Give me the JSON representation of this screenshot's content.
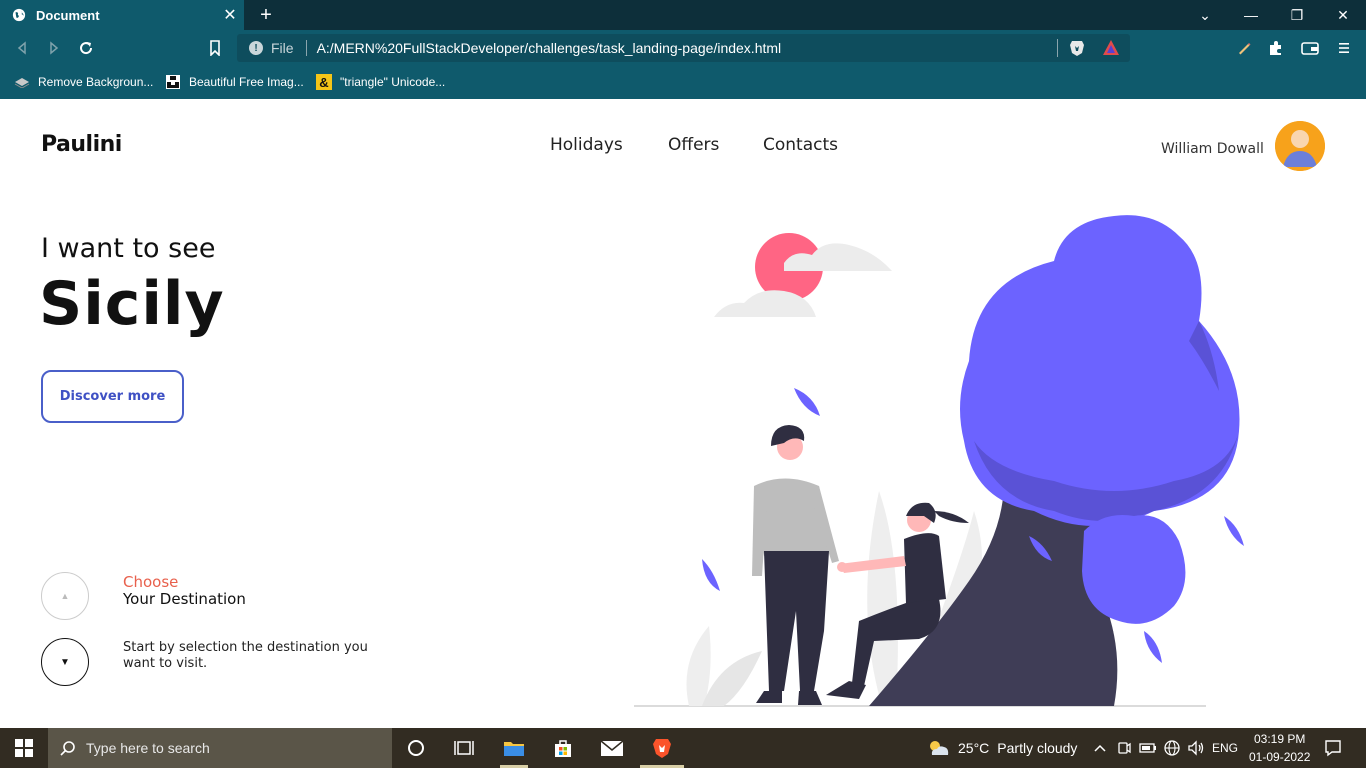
{
  "browser": {
    "tab": {
      "title": "Document",
      "close": "✕"
    },
    "new_tab": "+",
    "window_controls": {
      "minimize": "—",
      "restore": "❐",
      "close": "✕",
      "menu": "⌄"
    },
    "address": {
      "scheme_label": "File",
      "url": "A:/MERN%20FullStackDeveloper/challenges/task_landing-page/index.html"
    },
    "bookmarks": [
      {
        "label": "Remove Backgroun...",
        "icon": "remove-bg-icon"
      },
      {
        "label": "Beautiful Free Imag...",
        "icon": "unsplash-icon"
      },
      {
        "label": "\"triangle\" Unicode...",
        "icon": "ampersand-icon"
      }
    ]
  },
  "site": {
    "logo": "Paulini",
    "nav": {
      "holidays": "Holidays",
      "offers": "Offers",
      "contacts": "Contacts"
    },
    "user": {
      "name": "William Dowall"
    },
    "hero": {
      "subtitle": "I want to see",
      "title": "Sicily",
      "cta": "Discover more"
    },
    "steps": {
      "up_arrow": "▲",
      "down_arrow": "▼",
      "choose": "Choose",
      "destination": "Your Destination",
      "description": "Start by selection the destination you want to visit."
    },
    "colors": {
      "accent": "#6c63ff",
      "sun": "#ff6584",
      "choose": "#e8604c",
      "button": "#4a5fc9"
    }
  },
  "taskbar": {
    "search_placeholder": "Type here to search",
    "weather": {
      "temp": "25°C",
      "condition": "Partly cloudy"
    },
    "language": "ENG",
    "time": "03:19 PM",
    "date": "01-09-2022"
  }
}
